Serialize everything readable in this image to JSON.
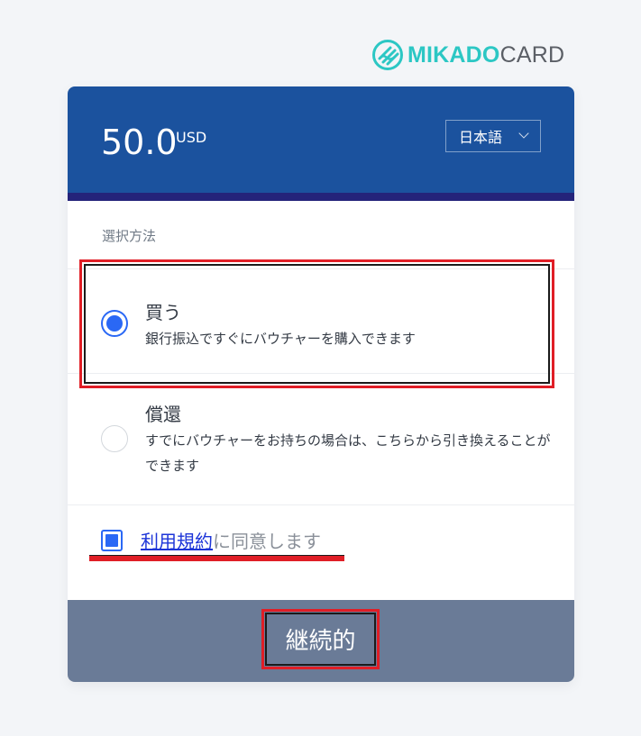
{
  "brand": {
    "name_part1": "MIKADO",
    "name_part2": "CARD",
    "colors": {
      "mikado": "#2cc7c4",
      "card": "#5b5f66"
    },
    "icon": "mikadocard-logo-icon"
  },
  "header": {
    "amount": "50.0",
    "currency": "USD",
    "language": "日本語",
    "bg_color": "#1b529e"
  },
  "method": {
    "label": "選択方法",
    "options": [
      {
        "title": "買う",
        "description": "銀行振込ですぐにバウチャーを購入できます",
        "selected": true
      },
      {
        "title": "償還",
        "description": "すでにバウチャーをお持ちの場合は、こちらから引き換えることができます",
        "selected": false
      }
    ]
  },
  "terms": {
    "link_text": "利用規約",
    "rest_text": "に同意します",
    "checked": true
  },
  "footer": {
    "continue_label": "継続的",
    "bg_color": "#6a7b97"
  },
  "accent_color": "#2a68f5",
  "annotation_color": "#e01e26"
}
